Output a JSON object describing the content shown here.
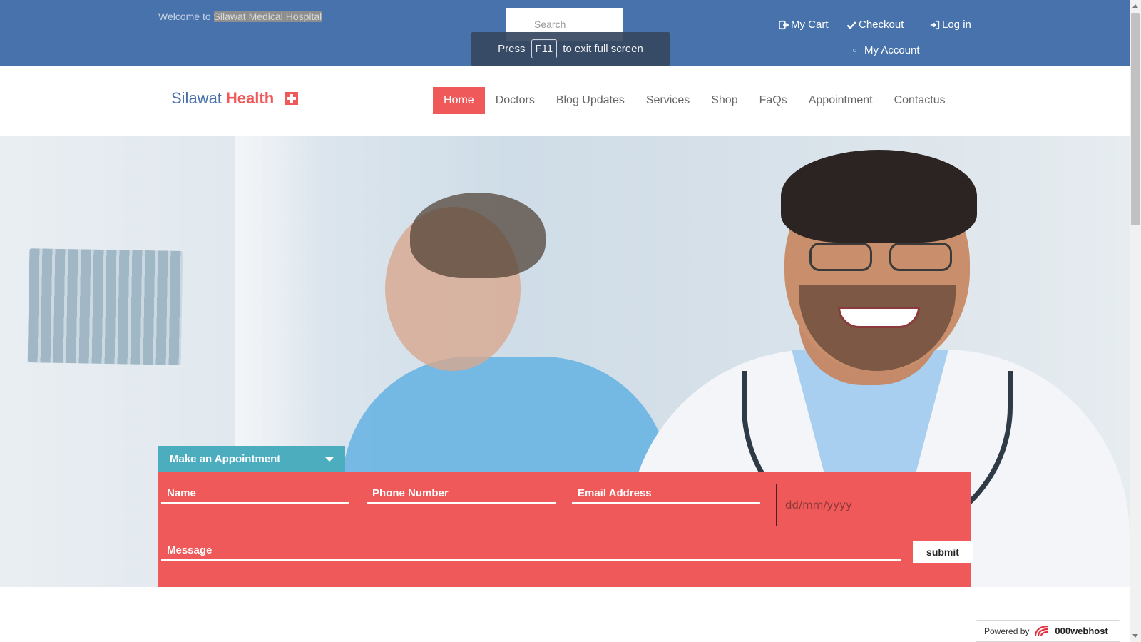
{
  "topbar": {
    "welcome_prefix": "Welcome to ",
    "hospital_name": "Silawat Medical Hospital",
    "search_placeholder": "Search",
    "fullscreen": {
      "press": "Press",
      "key": "F11",
      "suffix": "to exit full screen"
    },
    "links": {
      "cart": "My Cart",
      "checkout": "Checkout",
      "login": "Log in",
      "account": "My Account"
    }
  },
  "logo": {
    "part1": "Silawat",
    "part2": "Health"
  },
  "nav": {
    "items": [
      "Home",
      "Doctors",
      "Blog Updates",
      "Services",
      "Shop",
      "FaQs",
      "Appointment",
      "Contactus"
    ],
    "active": "Home"
  },
  "appointment": {
    "tab_label": "Make an Appointment",
    "name_placeholder": "Name",
    "phone_placeholder": "Phone Number",
    "email_placeholder": "Email Address",
    "date_placeholder": "dd/mm/yyyy",
    "message_placeholder": "Message",
    "submit_label": "submit"
  },
  "footer": {
    "powered_by": "Powered by",
    "brand": "000webhost"
  },
  "colors": {
    "topbar": "#4872ac",
    "accent": "#ef5959",
    "teal": "#4cadbf"
  }
}
